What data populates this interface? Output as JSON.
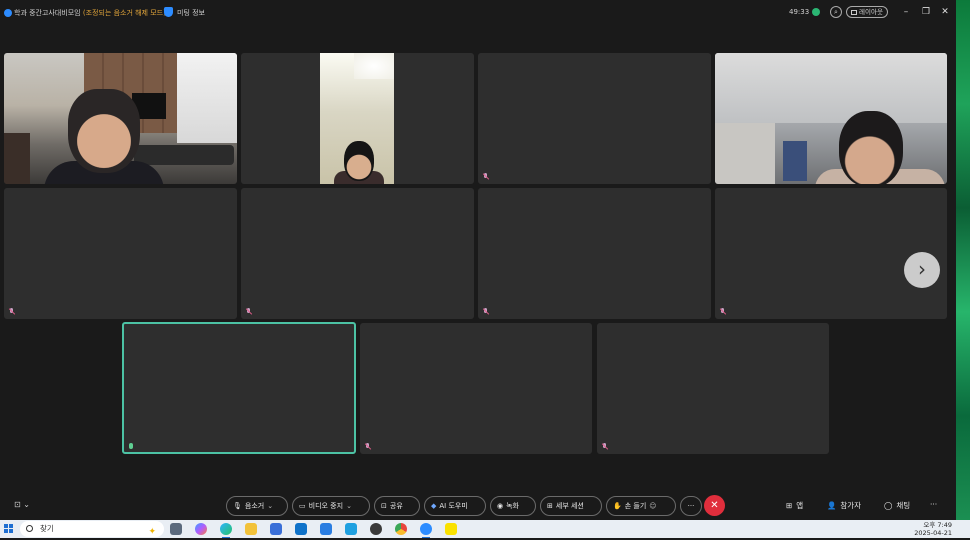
{
  "titlebar": {
    "meeting_title_prefix": "학과 중간고사대비모임",
    "meeting_title_status": "(조정되는 음소거 해제 모드)",
    "meeting_info_label": "미팅 정보",
    "timer": "49:33",
    "layout_label": "레이아웃",
    "win_minimize": "–",
    "win_restore": "❐",
    "win_close": "✕"
  },
  "tiles": {
    "next_page": "›"
  },
  "toolbar": {
    "chat_toggle": "⊡ ⌄",
    "mute_label": "음소거",
    "video_label": "비디오 중지",
    "share_label": "공유",
    "ai_label": "AI 도우미",
    "record_label": "녹화",
    "breakout_label": "세부 세션",
    "raise_hand_label": "손 들기",
    "more_label": "···",
    "leave_icon": "✕",
    "apps_label": "앱",
    "participants_label": "참가자",
    "chat_label": "채팅",
    "overflow_label": "···"
  },
  "taskbar": {
    "search_placeholder": "찾기",
    "time": "오후 7:49",
    "date": "2025-04-21"
  },
  "colors": {
    "accent_active_tile": "#4cc2a4",
    "leave": "#e02e3c",
    "status_green": "#2bb673",
    "status_text": "#e0a43a"
  }
}
